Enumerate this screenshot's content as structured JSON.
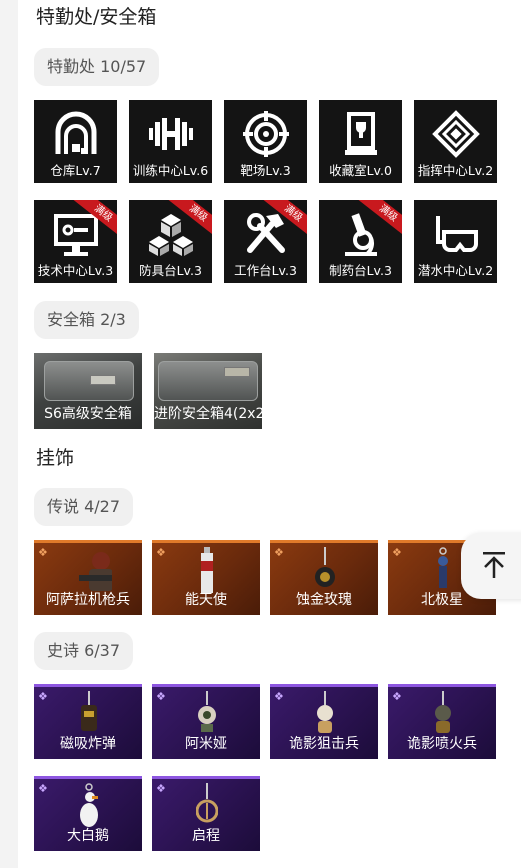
{
  "hq": {
    "title": "特勤处/安全箱",
    "chip": "特勤处 10/57",
    "row1": [
      {
        "label": "仓库Lv.7",
        "icon": "warehouse-icon",
        "maxed": false
      },
      {
        "label": "训练中心Lv.6",
        "icon": "dumbbell-icon",
        "maxed": false
      },
      {
        "label": "靶场Lv.3",
        "icon": "target-icon",
        "maxed": false
      },
      {
        "label": "收藏室Lv.0",
        "icon": "trophy-case-icon",
        "maxed": false
      },
      {
        "label": "指挥中心Lv.2",
        "icon": "chip-icon",
        "maxed": false
      }
    ],
    "row2": [
      {
        "label": "技术中心Lv.3",
        "icon": "monitor-icon",
        "maxed": true
      },
      {
        "label": "防具台Lv.3",
        "icon": "boxes-icon",
        "maxed": true
      },
      {
        "label": "工作台Lv.3",
        "icon": "tools-icon",
        "maxed": true
      },
      {
        "label": "制药台Lv.3",
        "icon": "microscope-icon",
        "maxed": true
      },
      {
        "label": "潜水中心Lv.2",
        "icon": "diving-mask-icon",
        "maxed": false
      }
    ],
    "maxed_label": "满级"
  },
  "safes": {
    "chip": "安全箱 2/3",
    "items": [
      {
        "label": "S6高级安全箱"
      },
      {
        "label": "进阶安全箱4(2x2"
      }
    ]
  },
  "charms": {
    "title": "挂饰",
    "legendary": {
      "chip": "传说 4/27",
      "items": [
        {
          "label": "阿萨拉机枪兵"
        },
        {
          "label": "能天使"
        },
        {
          "label": "蚀金玫瑰"
        },
        {
          "label": "北极星"
        }
      ]
    },
    "epic": {
      "chip": "史诗 6/37",
      "row1": [
        {
          "label": "磁吸炸弹"
        },
        {
          "label": "阿米娅"
        },
        {
          "label": "诡影狙击兵"
        },
        {
          "label": "诡影喷火兵"
        }
      ],
      "row2": [
        {
          "label": "大白鹅"
        },
        {
          "label": "启程"
        }
      ]
    }
  },
  "fab": {
    "icon": "back-to-top-icon"
  },
  "colors": {
    "ribbon": "#c8191e",
    "legendary": "#e07a2a",
    "epic": "#8d56e0"
  }
}
